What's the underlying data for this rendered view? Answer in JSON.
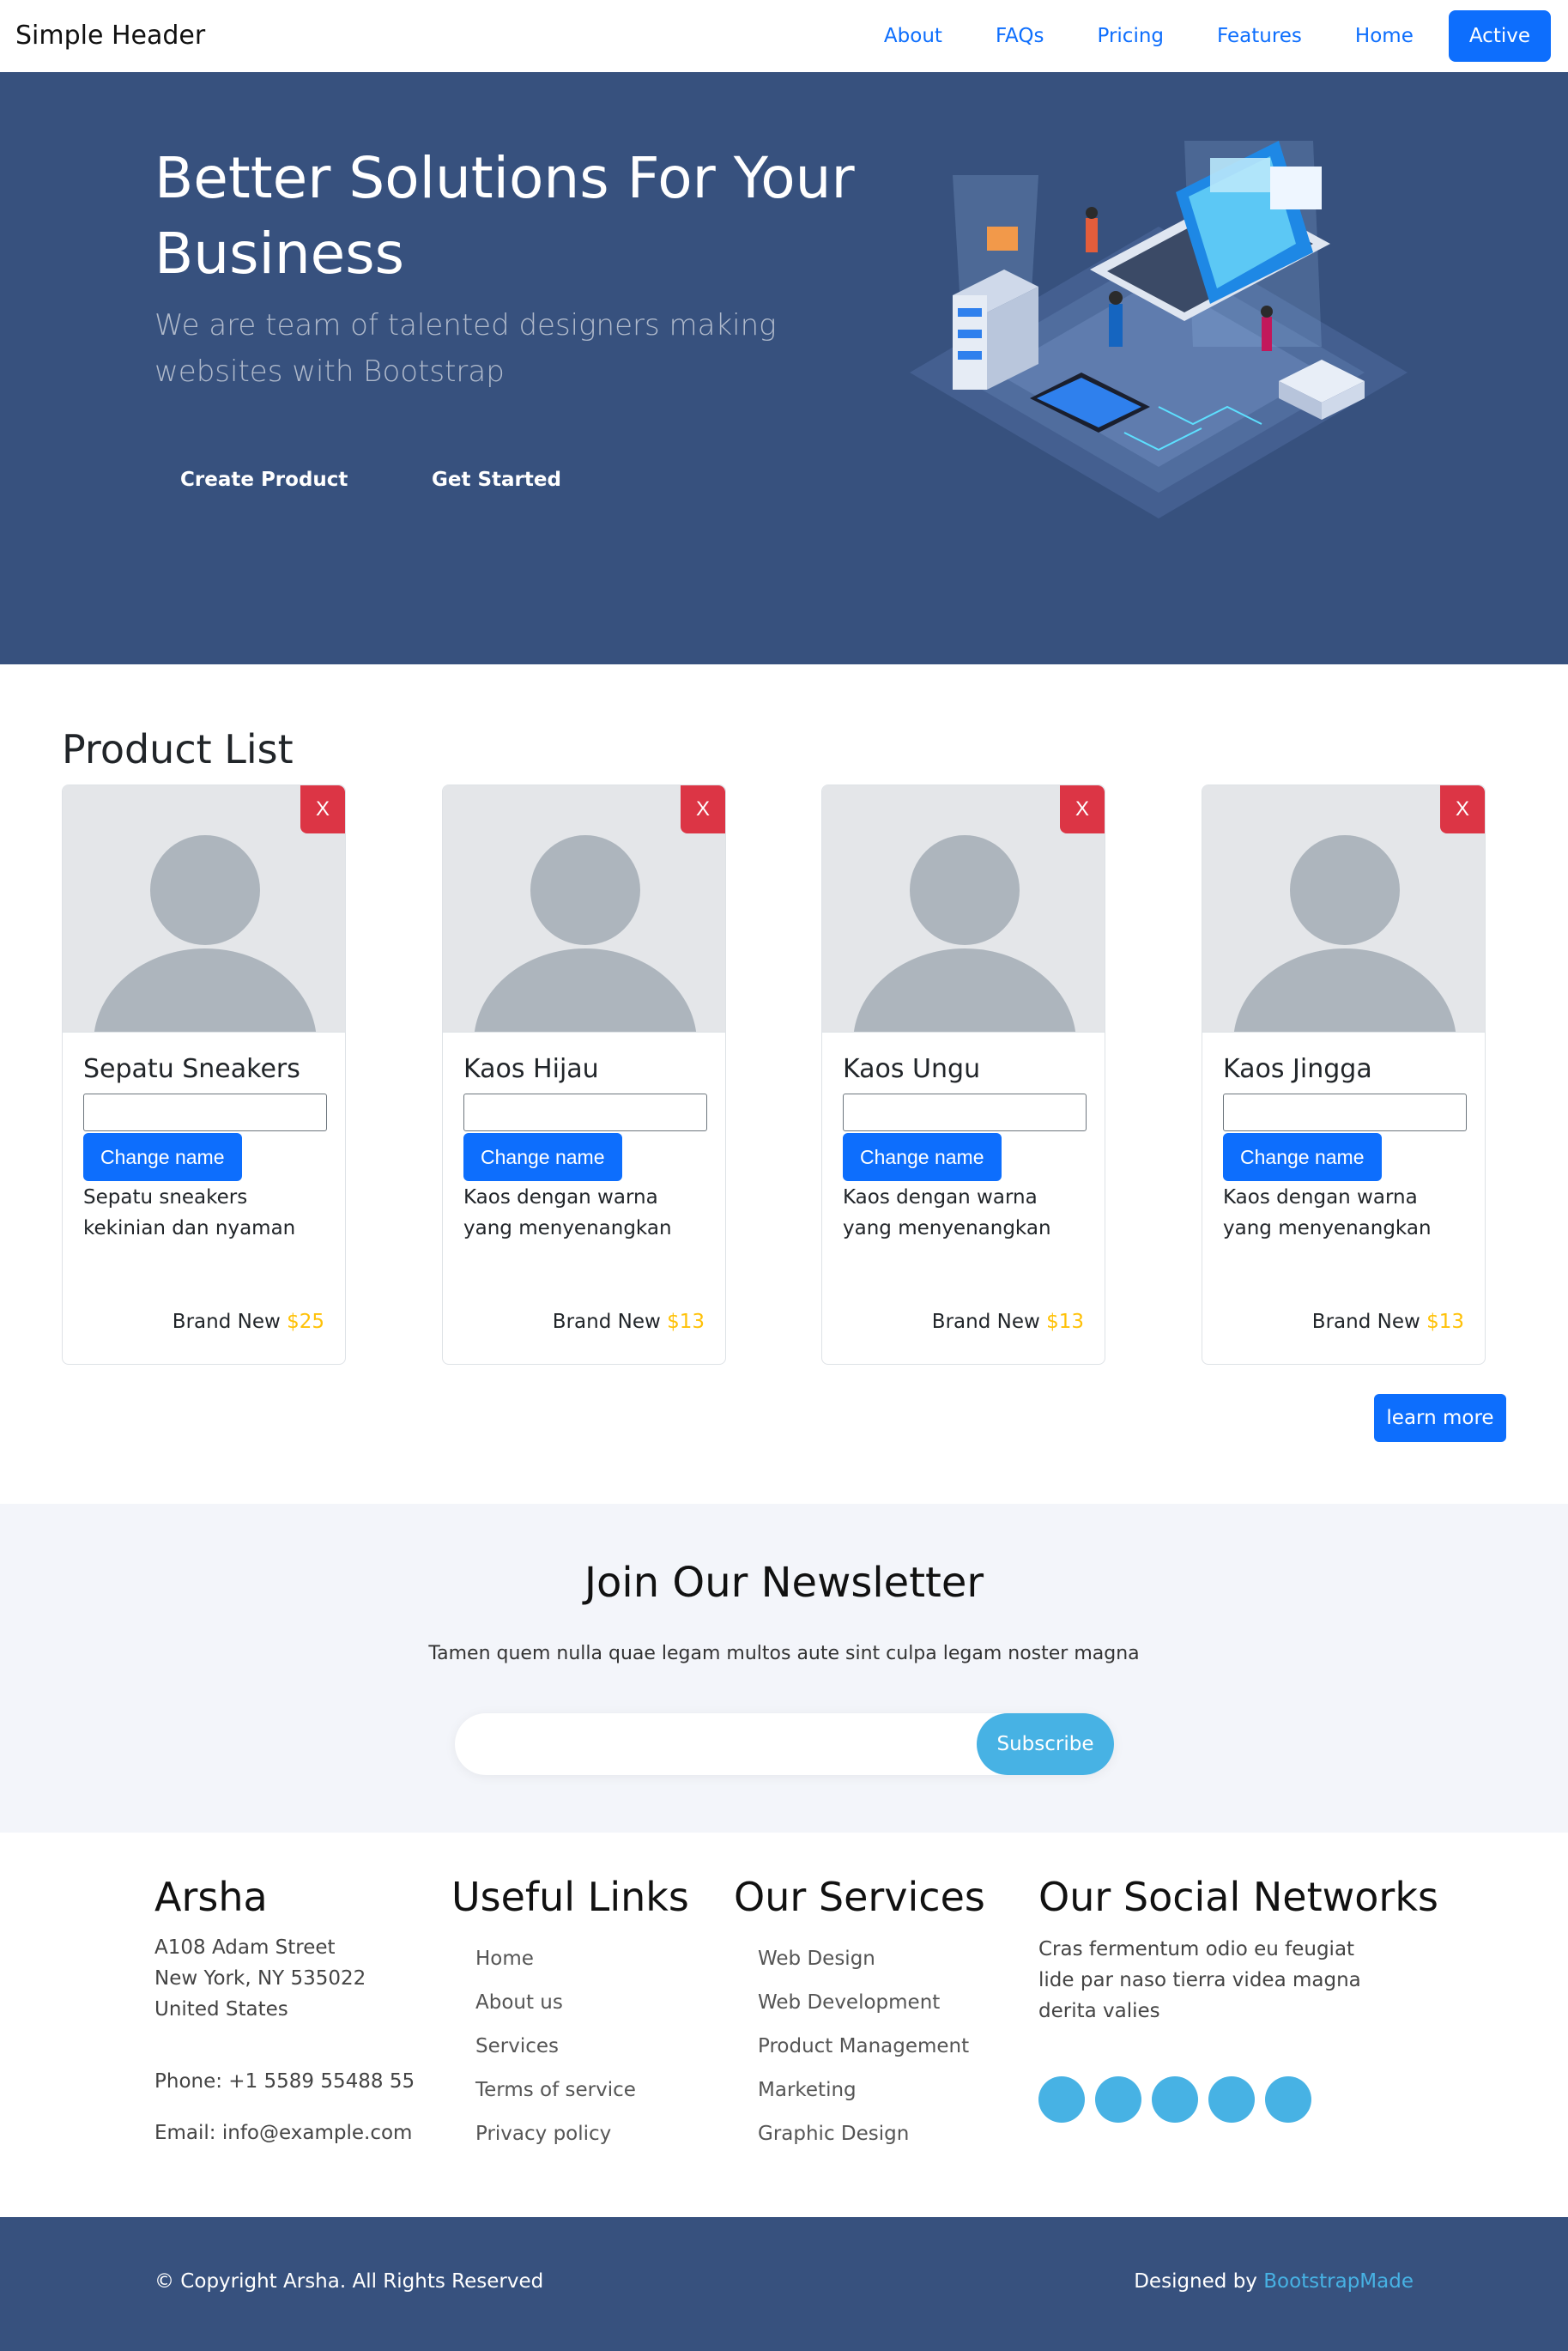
{
  "header": {
    "brand": "Simple Header",
    "nav": [
      "About",
      "FAQs",
      "Pricing",
      "Features",
      "Home",
      "Active"
    ]
  },
  "hero": {
    "title": "Better Solutions For Your Business",
    "subtitle": "We are team of talented designers making websites with Bootstrap",
    "buttons": [
      "Create Product",
      "Get Started"
    ]
  },
  "products": {
    "title": "Product List",
    "delete_label": "X",
    "change_label": "Change name",
    "price_prefix": "Brand New",
    "items": [
      {
        "name": "Sepatu Sneakers",
        "desc": "Sepatu sneakers kekinian dan nyaman",
        "price": "$25"
      },
      {
        "name": "Kaos Hijau",
        "desc": "Kaos dengan warna yang menyenangkan",
        "price": "$13"
      },
      {
        "name": "Kaos Ungu",
        "desc": "Kaos dengan warna yang menyenangkan",
        "price": "$13"
      },
      {
        "name": "Kaos Jingga",
        "desc": "Kaos dengan warna yang menyenangkan",
        "price": "$13"
      }
    ],
    "learn_more": "learn more"
  },
  "newsletter": {
    "title": "Join Our Newsletter",
    "text": "Tamen quem nulla quae legam multos aute sint culpa legam noster magna",
    "button": "Subscribe"
  },
  "footer": {
    "company": {
      "name": "Arsha",
      "address": [
        "A108 Adam Street",
        "New York, NY 535022",
        "United States"
      ],
      "phone": "Phone: +1 5589 55488 55",
      "email": "Email: info@example.com"
    },
    "useful_links": {
      "title": "Useful Links",
      "items": [
        "Home",
        "About us",
        "Services",
        "Terms of service",
        "Privacy policy"
      ]
    },
    "services": {
      "title": "Our Services",
      "items": [
        "Web Design",
        "Web Development",
        "Product Management",
        "Marketing",
        "Graphic Design"
      ]
    },
    "social": {
      "title": "Our Social Networks",
      "text": "Cras fermentum odio eu feugiat lide par naso tierra videa magna derita valies"
    },
    "copyright": "© Copyright Arsha. All Rights Reserved",
    "designed_by": "Designed by",
    "designer": "BootstrapMade"
  },
  "colors": {
    "primary": "#0d6efd",
    "hero_bg": "#37517e",
    "accent": "#47b2e4",
    "danger": "#dc3545",
    "price": "#ffc107"
  }
}
